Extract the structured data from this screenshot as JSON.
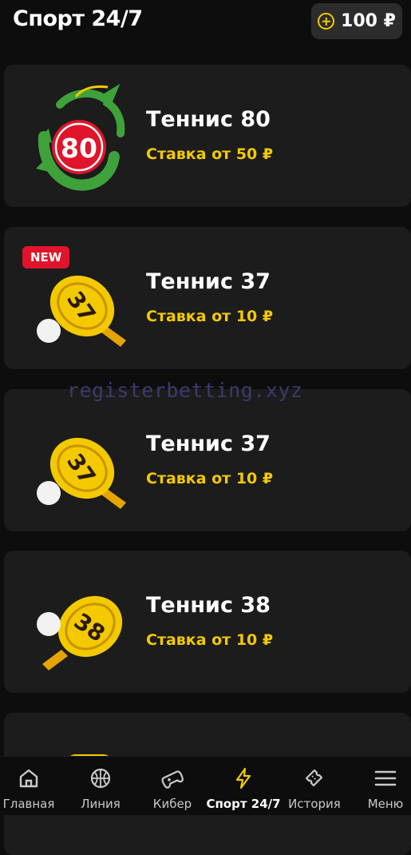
{
  "header": {
    "title": "Спорт 24/7",
    "balance": "100 ₽"
  },
  "cards": [
    {
      "name": "Теннис 80",
      "stake": "Ставка от 50 ₽",
      "badge": ""
    },
    {
      "name": "Теннис 37",
      "stake": "Ставка от 10 ₽",
      "badge": "NEW"
    },
    {
      "name": "Теннис 37",
      "stake": "Ставка от 10 ₽",
      "badge": ""
    },
    {
      "name": "Теннис 38",
      "stake": "Ставка от 10 ₽",
      "badge": ""
    },
    {
      "name": "",
      "stake": "",
      "badge": ""
    }
  ],
  "logos": {
    "dragon_number": "80",
    "paddle_1": "37",
    "paddle_2": "37",
    "paddle_3": "38"
  },
  "watermark": "registerbetting.xyz",
  "tabs": [
    {
      "label": "Главная",
      "icon": "home-icon"
    },
    {
      "label": "Линия",
      "icon": "ball-icon"
    },
    {
      "label": "Кибер",
      "icon": "gamepad-icon"
    },
    {
      "label": "Спорт 24/7",
      "icon": "lightning-icon"
    },
    {
      "label": "История",
      "icon": "ticket-icon"
    },
    {
      "label": "Меню",
      "icon": "menu-icon"
    }
  ],
  "colors": {
    "accent": "#f3c900",
    "badge": "#e0142a",
    "card": "#1c1c1c",
    "bg": "#0d0d0d"
  }
}
